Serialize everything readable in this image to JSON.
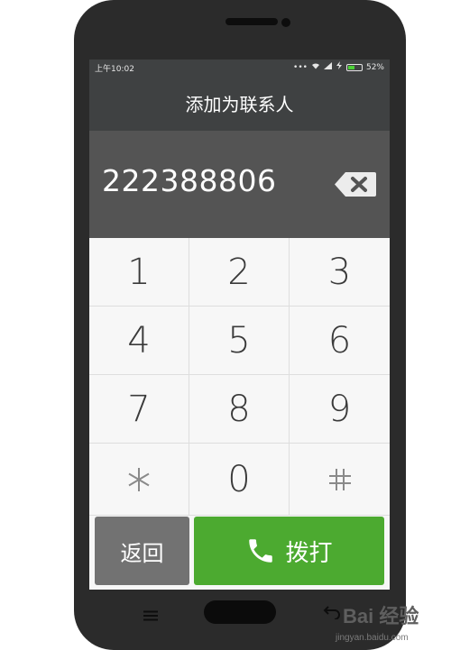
{
  "status_bar": {
    "time": "上午10:02",
    "icons": [
      "dots-icon",
      "wifi-icon",
      "signal-icon",
      "charging-icon",
      "battery-icon"
    ],
    "battery_percent": "52%",
    "battery_level": 0.52
  },
  "header": {
    "title": "添加为联系人"
  },
  "number_display": {
    "value": "222388806",
    "backspace_icon": "backspace-icon"
  },
  "keypad": {
    "keys": [
      "1",
      "2",
      "3",
      "4",
      "5",
      "6",
      "7",
      "8",
      "9",
      "*",
      "0",
      "#"
    ]
  },
  "actions": {
    "back_label": "返回",
    "dial_label": "拨打",
    "dial_icon": "phone-icon"
  },
  "navbar": {
    "icons": [
      "menu-icon",
      "home-button",
      "back-arrow-icon"
    ]
  },
  "watermark": {
    "logo_text": "Bai 经验",
    "url": "jingyan.baidu.com"
  },
  "colors": {
    "header_bg": "#3f4142",
    "number_bg": "#545454",
    "keypad_bg": "#f7f7f7",
    "back_btn": "#727272",
    "dial_btn": "#4caa30",
    "phone_body": "#2b2b2b"
  }
}
